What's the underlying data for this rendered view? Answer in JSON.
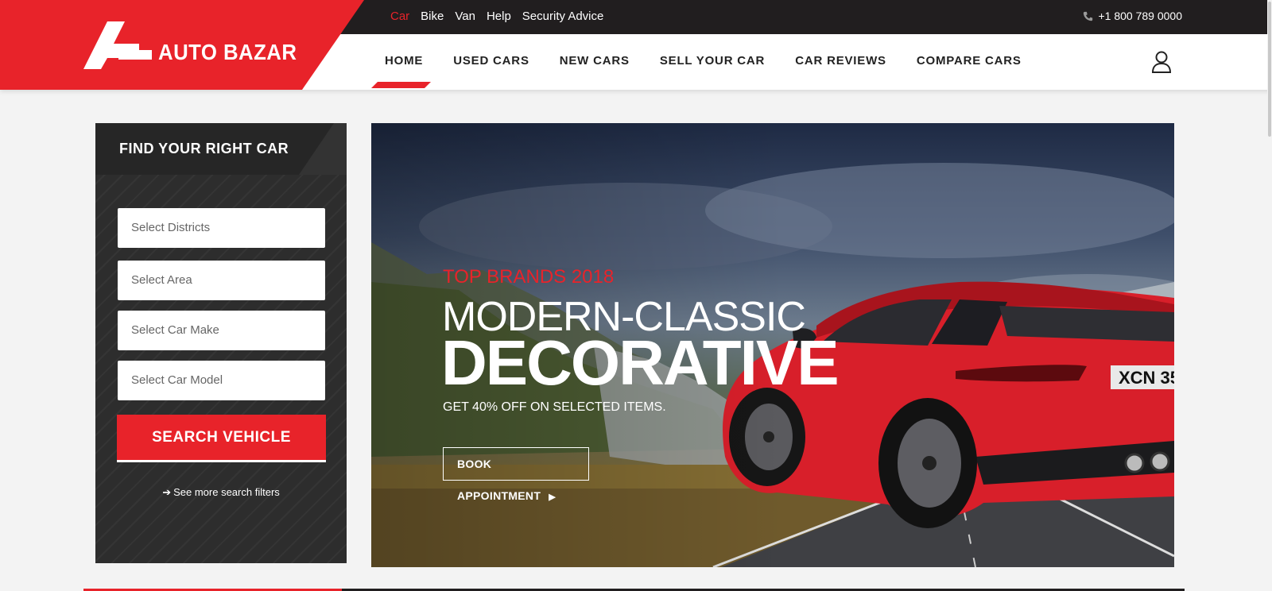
{
  "brand": {
    "name": "AUTO BAZAR",
    "logo": "auto-bazar-logo",
    "color": "#e8232a"
  },
  "topnav": {
    "items": [
      "Car",
      "Bike",
      "Van",
      "Help",
      "Security Advice"
    ],
    "active": "Car"
  },
  "contact": {
    "phone": "+1 800 789 0000",
    "icon": "phone-icon"
  },
  "mainnav": {
    "items": [
      "HOME",
      "USED CARS",
      "NEW CARS",
      "SELL YOUR CAR",
      "CAR REVIEWS",
      "COMPARE CARS"
    ],
    "active": "HOME"
  },
  "account": {
    "icon": "user-icon"
  },
  "search_panel": {
    "title": "FIND YOUR RIGHT CAR",
    "fields": [
      "Select Districts",
      "Select Area",
      "Select Car Make",
      "Select Car Model"
    ],
    "button": "SEARCH VEHICLE",
    "more_link": "See more search filters"
  },
  "hero": {
    "eyebrow": "TOP BRANDS 2018",
    "title_line1": "MODERN-CLASSIC",
    "title_line2": "DECORATIVE",
    "offer": "GET 40% OFF ON SELECTED ITEMS.",
    "cta": "BOOK APPOINTMENT",
    "plate": "XCN 35"
  },
  "colors": {
    "accent": "#e8232a",
    "dark": "#211e1f",
    "panel": "#2d2d2d"
  }
}
